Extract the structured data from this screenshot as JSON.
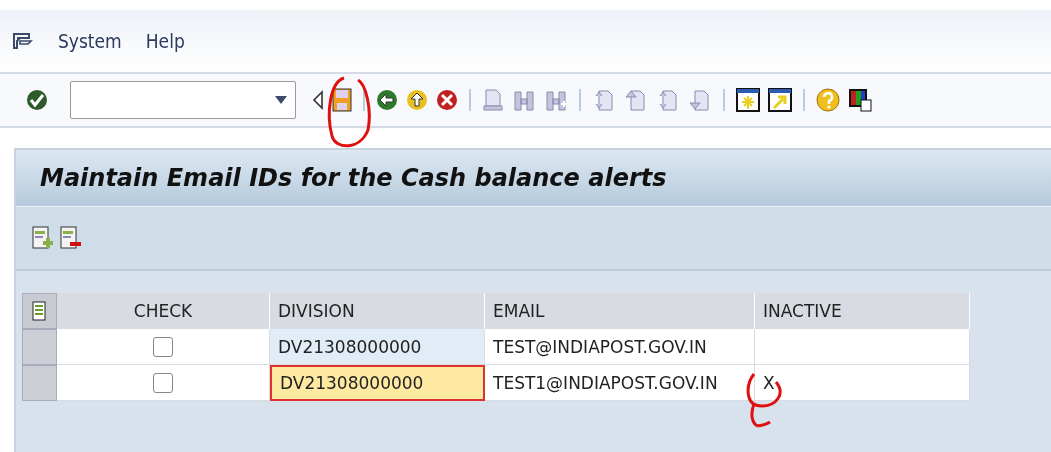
{
  "menu": [
    {
      "label": "System"
    },
    {
      "label": "Help"
    }
  ],
  "screen_title": "Maintain Email IDs for the Cash balance alerts",
  "table": {
    "columns": [
      "CHECK",
      "DIVISION",
      "EMAIL",
      "INACTIVE"
    ],
    "rows": [
      {
        "checked": false,
        "division": "DV21308000000",
        "division_focused": false,
        "email": "TEST@INDIAPOST.GOV.IN"
      },
      {
        "checked": false,
        "division": "DV21308000000",
        "division_focused": true,
        "email": "TEST1@INDIAPOST.GOV.IN",
        "inactive": "X"
      }
    ]
  }
}
